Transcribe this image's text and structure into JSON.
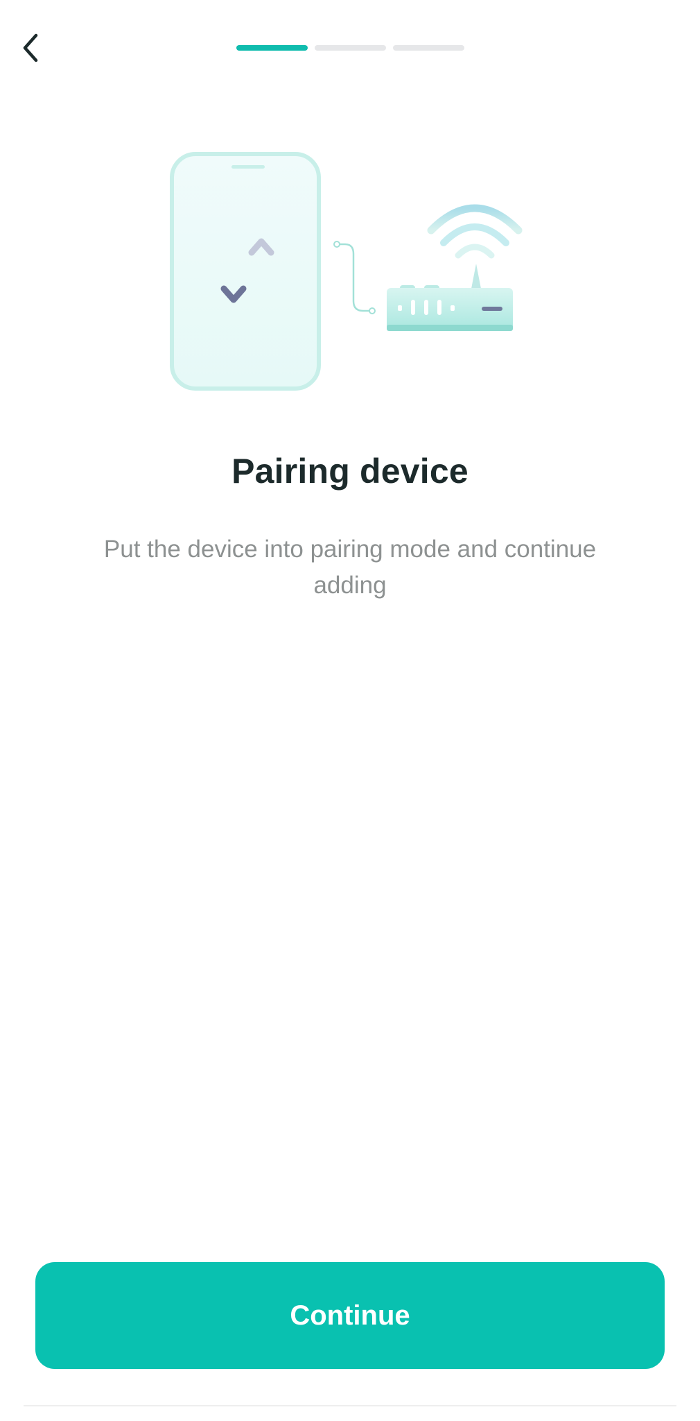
{
  "header": {
    "back_icon": "chevron-left-icon",
    "progress": {
      "total_steps": 3,
      "current_step": 1
    }
  },
  "illustration": {
    "icons": [
      "phone-icon",
      "transfer-arrows-icon",
      "router-icon",
      "wifi-signal-icon"
    ]
  },
  "main": {
    "title": "Pairing device",
    "subtitle": "Put the device into pairing mode and continue adding"
  },
  "footer": {
    "continue_label": "Continue"
  },
  "colors": {
    "accent": "#09c1b0",
    "progress_active": "#10bcae",
    "progress_inactive": "#e6e7e9",
    "title": "#1c2a2b",
    "subtitle": "#8d9191"
  }
}
